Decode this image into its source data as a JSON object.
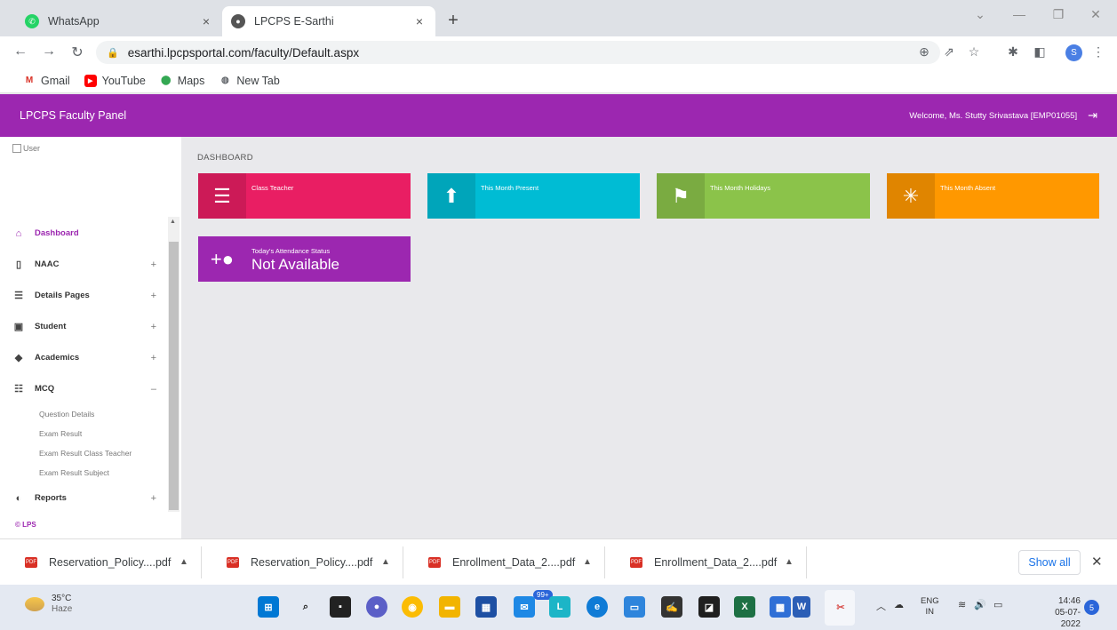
{
  "browser": {
    "tabs": [
      {
        "title": "WhatsApp",
        "icon": "whatsapp-icon",
        "color": "#25d366"
      },
      {
        "title": "LPCPS E-Sarthi",
        "icon": "site-icon",
        "color": "#555555"
      }
    ],
    "close_glyph": "×",
    "new_tab_glyph": "+",
    "url": "esarthi.lpcpsportal.com/faculty/Default.aspx",
    "profile_letter": "S",
    "bookmarks": [
      {
        "label": "Gmail",
        "icon": "gmail-icon"
      },
      {
        "label": "YouTube",
        "icon": "youtube-icon"
      },
      {
        "label": "Maps",
        "icon": "maps-icon"
      },
      {
        "label": "New Tab",
        "icon": "globe-icon"
      }
    ]
  },
  "app": {
    "title": "LPCPS Faculty Panel",
    "welcome": "Welcome, Ms. Stutty Srivastava [EMP01055]",
    "user_image_alt": "User",
    "accent": "#9c27b0"
  },
  "sidebar": {
    "items": [
      {
        "label": "Dashboard",
        "icon": "home-icon",
        "expand": ""
      },
      {
        "label": "NAAC",
        "icon": "book-icon",
        "expand": "+"
      },
      {
        "label": "Details Pages",
        "icon": "list-icon",
        "expand": "+"
      },
      {
        "label": "Student",
        "icon": "student-icon",
        "expand": "+"
      },
      {
        "label": "Academics",
        "icon": "graduation-icon",
        "expand": "+"
      },
      {
        "label": "MCQ",
        "icon": "mcq-icon",
        "expand": "–"
      }
    ],
    "mcq_sub": [
      "Question Details",
      "Exam Result",
      "Exam Result Class Teacher",
      "Exam Result Subject"
    ],
    "reports": {
      "label": "Reports",
      "icon": "reports-icon",
      "expand": "+"
    },
    "copyright": "© LPS"
  },
  "dashboard": {
    "breadcrumb": "DASHBOARD",
    "cards": [
      {
        "label": "Class Teacher",
        "value": "",
        "color": "#e91e63",
        "icon": "checklist-icon"
      },
      {
        "label": "This Month Present",
        "value": "",
        "color": "#00bcd4",
        "icon": "present-icon"
      },
      {
        "label": "This Month Holidays",
        "value": "",
        "color": "#8bc34a",
        "icon": "holiday-icon"
      },
      {
        "label": "This Month Absent",
        "value": "",
        "color": "#ff9800",
        "icon": "absent-icon"
      },
      {
        "label": "Today's Attendance Status",
        "value": "Not Available",
        "color": "#9c27b0",
        "icon": "add-person-icon"
      }
    ]
  },
  "downloads": {
    "files": [
      "Reservation_Policy....pdf",
      "Reservation_Policy....pdf",
      "Enrollment_Data_2....pdf",
      "Enrollment_Data_2....pdf"
    ],
    "show_all": "Show all"
  },
  "taskbar": {
    "temperature": "35°C",
    "weather": "Haze",
    "badge": "99+",
    "lang_line1": "ENG",
    "lang_line2": "IN",
    "time": "14:46",
    "date": "05-07-2022",
    "notifications": "5"
  }
}
